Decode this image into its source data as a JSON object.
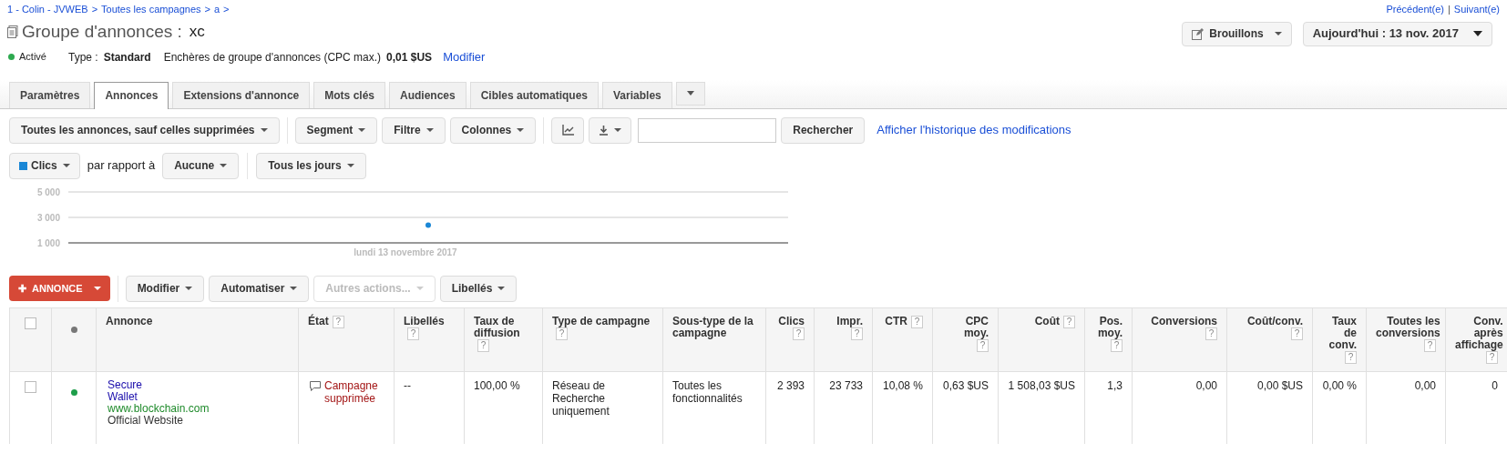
{
  "breadcrumb": [
    "1 - Colin - JVWEB",
    "Toutes les campagnes",
    "a"
  ],
  "breadcrumb_separator": ">",
  "pager": {
    "previous": "Précédent(e)",
    "separator": "|",
    "next": "Suivant(e)"
  },
  "title": {
    "label": "Groupe d'annonces :",
    "name": "xc"
  },
  "header_buttons": {
    "drafts": "Brouillons",
    "date": "Aujourd'hui : 13 nov. 2017"
  },
  "status": {
    "label": "Activé",
    "color": "#2da94f",
    "type_label": "Type :",
    "type_value": "Standard",
    "bid_label": "Enchères de groupe d'annonces (CPC max.)",
    "bid_value": "0,01 $US",
    "edit_link": "Modifier"
  },
  "tabs": [
    {
      "label": "Paramètres",
      "selected": false
    },
    {
      "label": "Annonces",
      "selected": true
    },
    {
      "label": "Extensions d'annonce",
      "selected": false
    },
    {
      "label": "Mots clés",
      "selected": false
    },
    {
      "label": "Audiences",
      "selected": false
    },
    {
      "label": "Cibles automatiques",
      "selected": false
    },
    {
      "label": "Variables",
      "selected": false
    }
  ],
  "toolbar": {
    "filter_menu": "Toutes les annonces, sauf celles supprimées",
    "segment": "Segment",
    "filter": "Filtre",
    "columns": "Colonnes",
    "search_button": "Rechercher",
    "history_link": "Afficher l'historique des modifications"
  },
  "chart_controls": {
    "compare_label": "par rapport à",
    "compare": "Aucune",
    "period": "Tous les jours"
  },
  "chart": {
    "chart_data": {
      "type": "scatter",
      "categories": [
        "lundi 13 novembre 2017"
      ],
      "series": [
        {
          "name": "Clics",
          "color": "#1a87d6",
          "values": [
            2400
          ]
        }
      ],
      "ylim": [
        1000,
        5000
      ],
      "yticks": [
        {
          "value": 1000,
          "label": "1 000"
        },
        {
          "value": 3000,
          "label": "3 000"
        },
        {
          "value": 5000,
          "label": "5 000"
        }
      ]
    }
  },
  "actions": {
    "new_ad": "ANNONCE",
    "new_ad_icon": "✚",
    "edit": "Modifier",
    "automate": "Automatiser",
    "other": "Autres actions...",
    "labels": "Libellés"
  },
  "table": {
    "select_all_checked": false,
    "columns": [
      {
        "label": "Annonce",
        "help": false,
        "kind": "text"
      },
      {
        "label": "État",
        "help": true,
        "kind": "text"
      },
      {
        "label": "Libellés",
        "help": true,
        "kind": "text"
      },
      {
        "label": "Taux de diffusion",
        "help": true,
        "kind": "text"
      },
      {
        "label": "Type de campagne",
        "help": true,
        "kind": "text"
      },
      {
        "label": "Sous-type de la campagne",
        "help": false,
        "kind": "text"
      },
      {
        "label": "Clics",
        "help": true,
        "kind": "number"
      },
      {
        "label": "Impr.",
        "help": true,
        "kind": "number"
      },
      {
        "label": "CTR",
        "help": true,
        "kind": "number"
      },
      {
        "label": "CPC moy.",
        "help": true,
        "kind": "number"
      },
      {
        "label": "Coût",
        "help": true,
        "kind": "number"
      },
      {
        "label": "Pos. moy.",
        "help": true,
        "kind": "number"
      },
      {
        "label": "Conversions",
        "help": true,
        "kind": "number"
      },
      {
        "label": "Coût/conv.",
        "help": true,
        "kind": "number"
      },
      {
        "label": "Taux de conv.",
        "help": true,
        "kind": "number"
      },
      {
        "label": "Toutes les conversions",
        "help": true,
        "kind": "number"
      },
      {
        "label": "Conv. après affichage",
        "help": true,
        "kind": "number"
      }
    ],
    "help_mark": "?",
    "rows": [
      {
        "checked": false,
        "color": "#1e9e4a",
        "cells": [
          {
            "kind": "ad",
            "lines": [
              {
                "kind": "headline",
                "text": "Secure"
              },
              {
                "kind": "headline",
                "text": "Wallet"
              },
              {
                "kind": "url",
                "text": "www.blockchain.com"
              },
              {
                "kind": "description",
                "text": "Official Website"
              }
            ]
          },
          {
            "kind": "state",
            "text": "Campagne supprimée"
          },
          "--",
          "100,00 %",
          "Réseau de Recherche uniquement",
          "Toutes les fonctionnalités",
          "2 393",
          "23 733",
          "10,08 %",
          "0,63 $US",
          "1 508,03 $US",
          "1,3",
          "0,00",
          "0,00 $US",
          "0,00 %",
          "0,00",
          "0"
        ]
      }
    ]
  }
}
